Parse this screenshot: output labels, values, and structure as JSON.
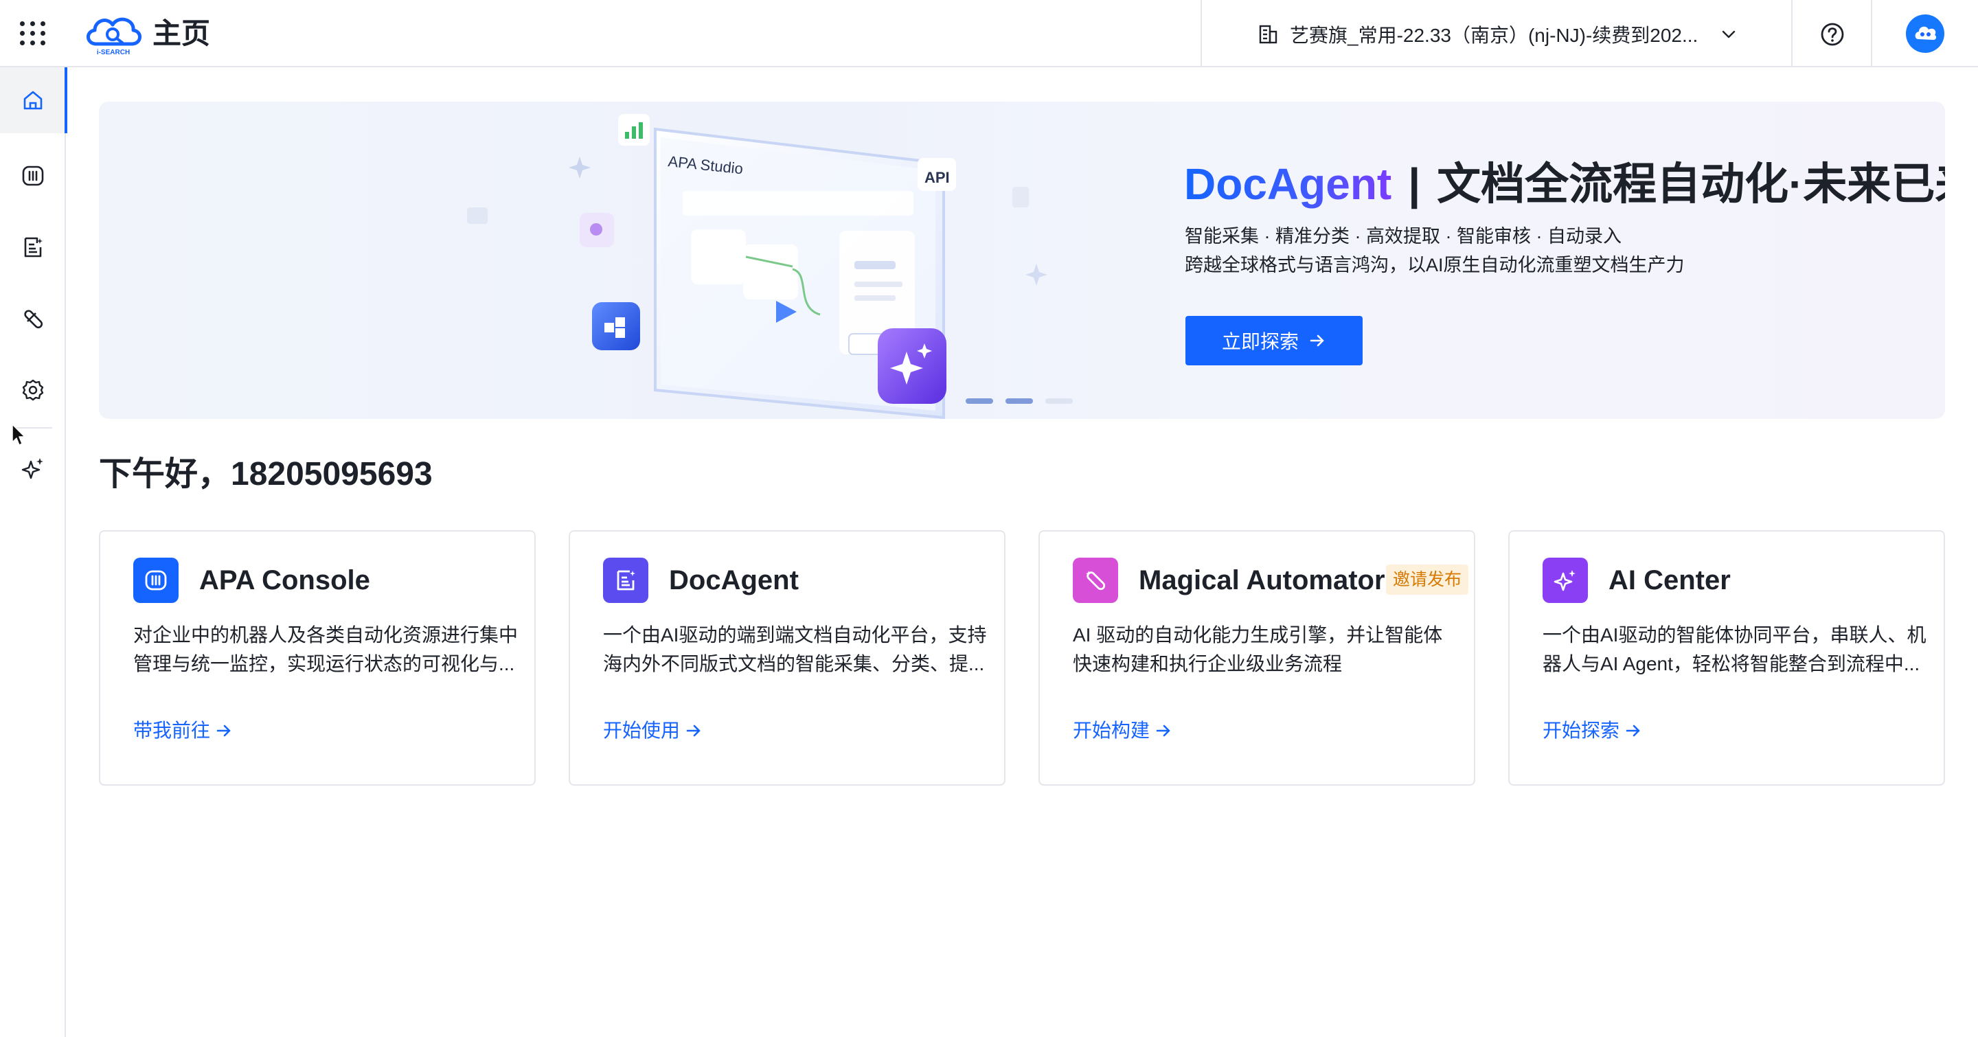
{
  "header": {
    "page_name": "主页",
    "logo_text": "i-SEARCH",
    "tenant_label": "艺赛旗_常用-22.33（南京）(nj-NJ)-续费到202...",
    "icons": {
      "apps": "grid-apps-icon",
      "tenant": "building-icon",
      "dropdown": "chevron-down-icon",
      "help": "help-circle-icon",
      "avatar": "robot-avatar-icon"
    }
  },
  "sidebar": {
    "items": [
      {
        "id": "home",
        "icon": "home-icon",
        "active": true
      },
      {
        "id": "console",
        "icon": "console-icon",
        "active": false
      },
      {
        "id": "docagent",
        "icon": "document-icon",
        "active": false
      },
      {
        "id": "automator",
        "icon": "wand-icon",
        "active": false
      },
      {
        "id": "settings",
        "icon": "gear-icon",
        "active": false
      },
      {
        "id": "ai",
        "icon": "sparkle-icon",
        "active": false
      }
    ]
  },
  "banner": {
    "studio_label": "APA Studio",
    "api_label": "API",
    "title_brand": "DocAgent",
    "title_sep": "|",
    "title_slogan": "文档全流程自动化·未来已来",
    "subtitle_1": "智能采集 · 精准分类 · 高效提取 · 智能审核 · 自动录入",
    "subtitle_2": "跨越全球格式与语言鸿沟，以AI原生自动化流重塑文档生产力",
    "button_label": "立即探索",
    "slides": 3,
    "active_slide": 1
  },
  "greeting": "下午好，18205095693",
  "cards": [
    {
      "title": "APA Console",
      "badge": "",
      "desc": "对企业中的机器人及各类自动化资源进行集中管理与统一监控，实现运行状态的可视化与...",
      "link": "带我前往",
      "icon": "console-icon",
      "color": "#1664ff"
    },
    {
      "title": "DocAgent",
      "badge": "",
      "desc": "一个由AI驱动的端到端文档自动化平台，支持海内外不同版式文档的智能采集、分类、提...",
      "link": "开始使用",
      "icon": "document-icon",
      "color": "#5b4cf0"
    },
    {
      "title": "Magical Automator",
      "badge": "邀请发布",
      "desc": "AI 驱动的自动化能力生成引擎，并让智能体快速构建和执行企业级业务流程",
      "link": "开始构建",
      "icon": "wand-icon",
      "color": "#d64fd6"
    },
    {
      "title": "AI Center",
      "badge": "",
      "desc": "一个由AI驱动的智能体协同平台，串联人、机器人与AI Agent，轻松将智能整合到流程中...",
      "link": "开始探索",
      "icon": "sparkle-icon",
      "color": "#8a3ff5"
    }
  ],
  "colors": {
    "primary": "#1664ff",
    "text": "#1d2129",
    "border": "#e5e6eb",
    "badge_bg": "#fdf1dc",
    "badge_text": "#d77a04"
  }
}
